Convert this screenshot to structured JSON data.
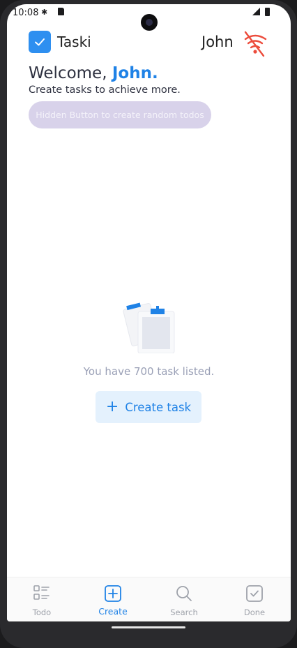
{
  "status_bar": {
    "time": "10:08"
  },
  "header": {
    "app_name": "Taski",
    "user_name": "John",
    "logo_icon": "check-icon",
    "connectivity_icon": "wifi-off-icon",
    "accent": "#2e8ff0",
    "offline_color": "#ec4c3c"
  },
  "welcome": {
    "greeting": "Welcome,",
    "name": "John.",
    "subtitle": "Create tasks to achieve more."
  },
  "hidden_button": {
    "label": "Hidden Button to create random todos"
  },
  "empty_state": {
    "illustration_icon": "clipboard-icon",
    "message": "You have 700 task listed.",
    "create_button": {
      "icon": "plus-icon",
      "label": "Create task"
    }
  },
  "bottom_nav": {
    "items": [
      {
        "label": "Todo",
        "icon": "list-icon",
        "active": false
      },
      {
        "label": "Create",
        "icon": "plus-square-icon",
        "active": true
      },
      {
        "label": "Search",
        "icon": "search-icon",
        "active": false
      },
      {
        "label": "Done",
        "icon": "check-square-icon",
        "active": false
      }
    ]
  },
  "colors": {
    "primary": "#1f82e6",
    "muted": "#9ea2aa",
    "hidden_button_bg": "#d8d2ea",
    "create_button_bg": "#e4f1fd"
  }
}
